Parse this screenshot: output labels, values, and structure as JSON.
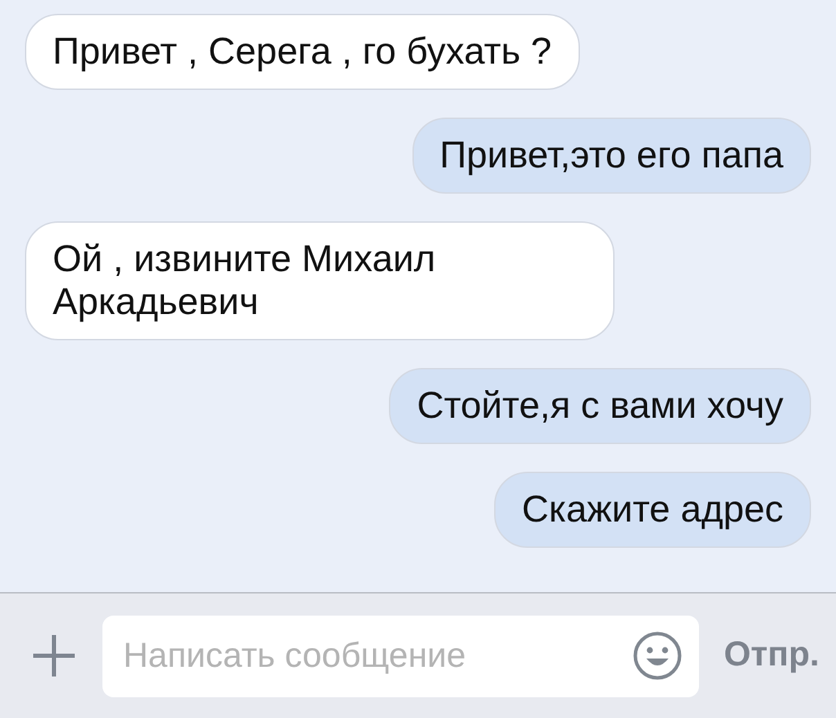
{
  "messages": [
    {
      "kind": "incoming",
      "text": "Привет , Серега , го бухать ?"
    },
    {
      "kind": "outgoing",
      "text": "Привет,это его папа"
    },
    {
      "kind": "incoming",
      "text": "Ой , извините Михаил Аркадьевич"
    },
    {
      "kind": "outgoing",
      "text": "Стойте,я с вами хочу"
    },
    {
      "kind": "outgoing",
      "text": "Скажите адрес"
    }
  ],
  "composer": {
    "placeholder": "Написать сообщение",
    "send_label": "Отпр."
  }
}
